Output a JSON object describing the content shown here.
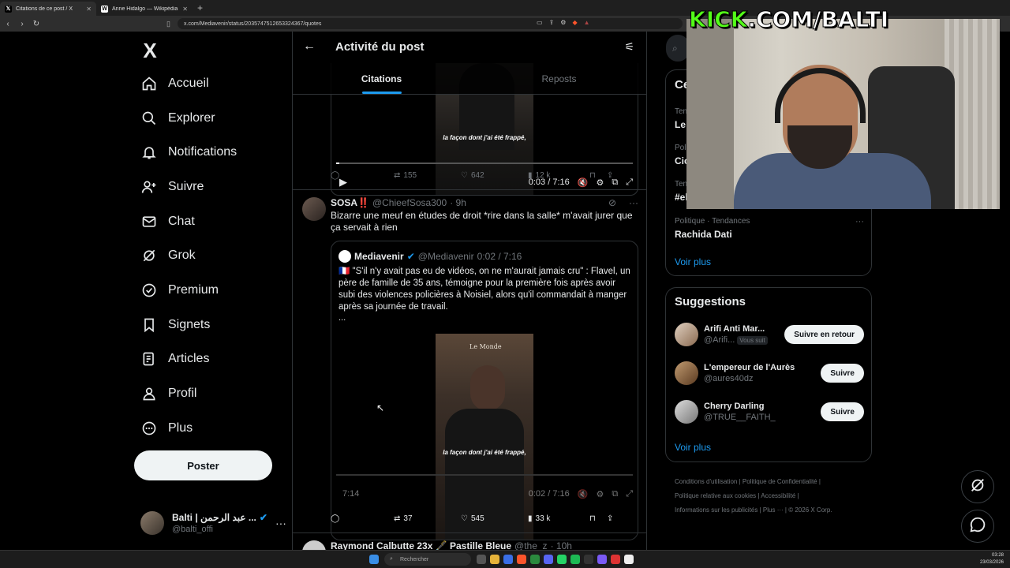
{
  "browser": {
    "tabs": [
      {
        "title": "Citations de ce post / X",
        "icon": "x-logo-icon"
      },
      {
        "title": "Anne Hidalgo — Wikipédia",
        "icon": "wikipedia-icon"
      }
    ],
    "url": "x.com/Mediavenir/status/2035747512653324367/quotes"
  },
  "nav": {
    "logo": "X",
    "items": [
      {
        "label": "Accueil",
        "icon": "home-icon"
      },
      {
        "label": "Explorer",
        "icon": "search-icon"
      },
      {
        "label": "Notifications",
        "icon": "bell-icon"
      },
      {
        "label": "Suivre",
        "icon": "person-add-icon"
      },
      {
        "label": "Chat",
        "icon": "mail-icon"
      },
      {
        "label": "Grok",
        "icon": "grok-icon"
      },
      {
        "label": "Premium",
        "icon": "premium-icon"
      },
      {
        "label": "Signets",
        "icon": "bookmark-icon"
      },
      {
        "label": "Articles",
        "icon": "article-icon"
      },
      {
        "label": "Profil",
        "icon": "person-icon"
      },
      {
        "label": "Plus",
        "icon": "more-circle-icon"
      }
    ],
    "post_button": "Poster",
    "account": {
      "display_name": "Balti | عبد الرحمن ...",
      "handle": "@balti_offi"
    }
  },
  "header": {
    "title": "Activité du post",
    "tabs": [
      "Citations",
      "Reposts"
    ]
  },
  "posts": {
    "first": {
      "video_caption": "la façon dont j'ai été frappé,",
      "time": "0:03 / 7:16",
      "replies": "",
      "reposts": "155",
      "likes": "642",
      "views": "12 k"
    },
    "second": {
      "name": "SOSA‼️",
      "handle": "@ChieefSosa300",
      "time": "· 9h",
      "text": "Bizarre une meuf en études de droit *rire dans la salle* m'avait jurer que ça servait à rien",
      "quote": {
        "name": "Mediavenir",
        "handle": "@Mediavenir",
        "time": "0:02 / 7:16",
        "text": "🇫🇷 \"S'il n'y avait pas eu de vidéos, on ne m'aurait jamais cru\" : Flavel, un père de famille de 35 ans, témoigne pour la première fois après avoir subi des violences policières à Noisiel, alors qu'il commandait à manger après sa journée de travail.",
        "more": "...",
        "video_brand": "Le Monde",
        "video_caption": "la façon dont j'ai été frappé,",
        "duration": "7:14"
      },
      "reposts": "37",
      "likes": "545",
      "views": "33 k"
    },
    "third": {
      "name": "Raymond Calbutte 23x 🖋️ Pastille Bleue",
      "handle": "@the_z",
      "time": "· 10h"
    }
  },
  "right": {
    "trends_title": "Ce",
    "trends": [
      {
        "category": "Tend",
        "name": "Le"
      },
      {
        "category": "Polit",
        "name": "Cio"
      },
      {
        "category": "Tend",
        "name": "#el"
      },
      {
        "category": "Politique · Tendances",
        "name": "Rachida Dati"
      }
    ],
    "see_more": "Voir plus",
    "suggestions_title": "Suggestions",
    "suggestions": [
      {
        "name": "Arifi Anti Mar...",
        "handle": "@Arifi...",
        "badge": "Vous suit",
        "button": "Suivre en retour"
      },
      {
        "name": "L'empereur de l'Aurès",
        "handle": "@aures40dz",
        "badge": "",
        "button": "Suivre"
      },
      {
        "name": "Cherry Darling",
        "handle": "@TRUE__FAITH_",
        "badge": "",
        "button": "Suivre"
      }
    ],
    "footer": {
      "line1": [
        "Conditions d'utilisation",
        "Politique de Confidentialité"
      ],
      "line2": [
        "Politique relative aux cookies",
        "Accessibilité"
      ],
      "line3": [
        "Informations sur les publicités",
        "Plus ···",
        "© 2026 X Corp."
      ]
    }
  },
  "overlay": {
    "kick_prefix": "KICK",
    "kick_rest": ".COM/BALTI"
  },
  "taskbar": {
    "search": "Rechercher",
    "time": "03:28",
    "date": "23/03/2026"
  }
}
